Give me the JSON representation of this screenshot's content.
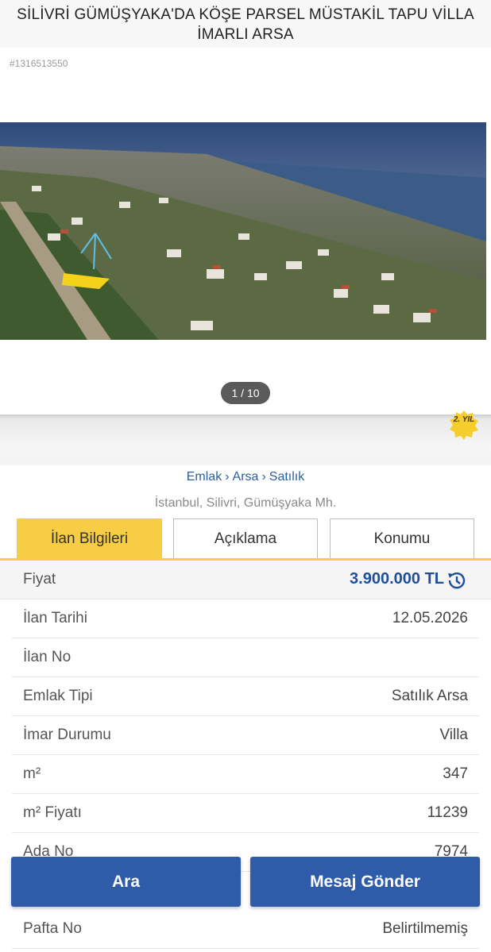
{
  "title": {
    "line1": "SİLİVRİ GÜMÜŞYAKA'DA KÖŞE PARSEL MÜSTAKİL TAPU VİLLA",
    "line2": "İMARLI ARSA"
  },
  "listing_id": "#1316513550",
  "gallery": {
    "counter": "1 / 10"
  },
  "badge": {
    "text": "2. YIL"
  },
  "breadcrumb": {
    "items": [
      "Emlak",
      "Arsa",
      "Satılık"
    ],
    "separator": "›"
  },
  "location": "İstanbul, Silivri, Gümüşyaka Mh.",
  "tabs": [
    {
      "label": "İlan Bilgileri",
      "active": true
    },
    {
      "label": "Açıklama",
      "active": false
    },
    {
      "label": "Konumu",
      "active": false
    }
  ],
  "info_rows": [
    {
      "key": "Fiyat",
      "value": "3.900.000 TL"
    },
    {
      "key": "İlan Tarihi",
      "value": "12.05.2026"
    },
    {
      "key": "İlan No",
      "value": ""
    },
    {
      "key": "Emlak Tipi",
      "value": "Satılık Arsa"
    },
    {
      "key": "İmar Durumu",
      "value": "Villa"
    },
    {
      "key": "m²",
      "value": "347"
    },
    {
      "key": "m² Fiyatı",
      "value": "11239"
    },
    {
      "key": "Ada No",
      "value": "7974"
    }
  ],
  "last_row": {
    "key": "Pafta No",
    "value": "Belirtilmemiş"
  },
  "actions": {
    "call": "Ara",
    "message": "Mesaj Gönder"
  },
  "colors": {
    "accent": "#f7cd46",
    "primary": "#2f5ca8",
    "price": "#1f4e9a",
    "link": "#2a5f9e"
  },
  "icons": {
    "price_history": "history-icon"
  }
}
